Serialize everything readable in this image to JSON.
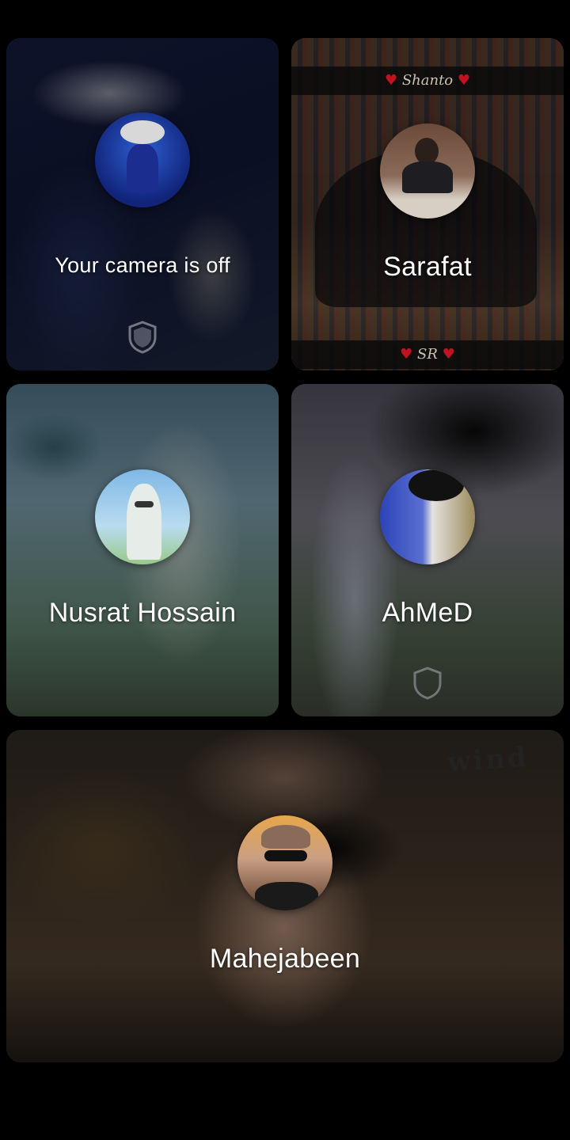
{
  "participants": [
    {
      "name": "Your camera is off",
      "self": true,
      "icon": "shield-icon"
    },
    {
      "name": "Sarafat",
      "banner_top": "Shanto",
      "banner_bottom": "SR"
    },
    {
      "name": "Nusrat Hossain"
    },
    {
      "name": "AhMeD",
      "icon": "shield-icon"
    },
    {
      "name": "Mahejabeen",
      "overlay_text": "wind"
    }
  ],
  "colors": {
    "background": "#000000",
    "text": "#ffffff",
    "heart": "#c0121f"
  }
}
